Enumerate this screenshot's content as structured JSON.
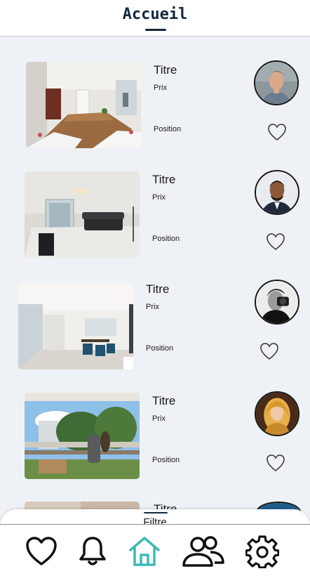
{
  "header": {
    "title": "Accueil"
  },
  "listings": [
    {
      "title": "Titre",
      "price": "Prix",
      "position": "Position"
    },
    {
      "title": "Titre",
      "price": "Prix",
      "position": "Position"
    },
    {
      "title": "Titre",
      "price": "Prix",
      "position": "Position"
    },
    {
      "title": "Titre",
      "price": "Prix",
      "position": "Position"
    },
    {
      "title": "Titre"
    }
  ],
  "filter": {
    "label": "Filtre"
  },
  "nav": [
    {
      "icon": "heart-icon"
    },
    {
      "icon": "bell-icon"
    },
    {
      "icon": "home-icon",
      "active": true
    },
    {
      "icon": "users-icon"
    },
    {
      "icon": "gear-icon"
    }
  ],
  "colors": {
    "header_text": "#13283d",
    "active_nav": "#3fb9b5",
    "background": "#eef2f6",
    "icon": "#111111"
  }
}
